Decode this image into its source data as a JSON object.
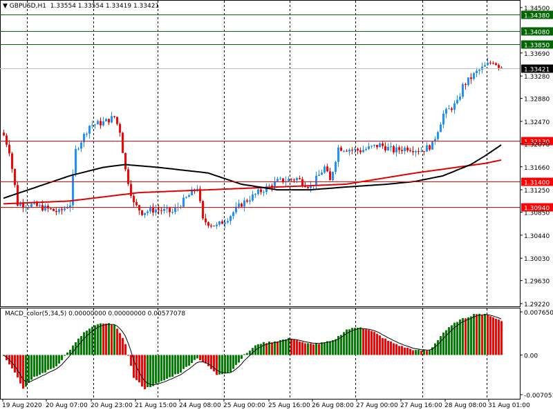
{
  "header": {
    "symbol": "GBPUSD,H1",
    "ohlc": "1.33554 1.33554 1.33419 1.33421"
  },
  "macd_header": {
    "label": "MACD_color(5,34,5) 0.00000000 0.00000000 0.00577078"
  },
  "colors": {
    "up": "#1e90ff",
    "down": "#ff0000",
    "ma_fast": "#000000",
    "ma_slow": "#e00000",
    "level_green": "#006400",
    "level_red": "#ff0000",
    "hist_up": "#008000",
    "hist_down": "#ff0000"
  },
  "price_axis": [
    "1.34500",
    "1.33690",
    "1.33280",
    "1.32880",
    "1.32470",
    "1.32070",
    "1.31660",
    "1.31250",
    "1.30850",
    "1.30440",
    "1.30030",
    "1.29630",
    "1.29220"
  ],
  "levels": [
    {
      "price": 1.3438,
      "label": "1.34380",
      "color": "green"
    },
    {
      "price": 1.3408,
      "label": "1.34080",
      "color": "green"
    },
    {
      "price": 1.3385,
      "label": "1.33850",
      "color": "green"
    },
    {
      "price": 1.3213,
      "label": "1.32130",
      "color": "red"
    },
    {
      "price": 1.314,
      "label": "1.31400",
      "color": "red"
    },
    {
      "price": 1.3094,
      "label": "1.30940",
      "color": "red"
    }
  ],
  "current_price": {
    "price": 1.33421,
    "label": "1.33421"
  },
  "macd_axis": {
    "top": "0.0076505",
    "zero": "0.00",
    "bottom": "-0.0070519"
  },
  "time_axis": [
    "19 Aug 2020",
    "20 Aug 07:00",
    "20 Aug 23:00",
    "21 Aug 15:00",
    "24 Aug 08:00",
    "25 Aug 00:00",
    "25 Aug 16:00",
    "26 Aug 08:00",
    "27 Aug 00:00",
    "27 Aug 16:00",
    "28 Aug 08:00",
    "31 Aug 01:00"
  ],
  "chart_data": {
    "type": "candlestick",
    "title": "GBPUSD,H1",
    "ylim": [
      1.2922,
      1.345
    ],
    "bars": 181,
    "close_path": [
      [
        0,
        1.3222
      ],
      [
        2,
        1.3195
      ],
      [
        5,
        1.31
      ],
      [
        10,
        1.3098
      ],
      [
        15,
        1.3092
      ],
      [
        20,
        1.3085
      ],
      [
        24,
        1.31
      ],
      [
        26,
        1.3195
      ],
      [
        31,
        1.324
      ],
      [
        36,
        1.3245
      ],
      [
        40,
        1.3255
      ],
      [
        42,
        1.323
      ],
      [
        44,
        1.316
      ],
      [
        47,
        1.31
      ],
      [
        50,
        1.3085
      ],
      [
        55,
        1.309
      ],
      [
        61,
        1.3085
      ],
      [
        66,
        1.311
      ],
      [
        70,
        1.313
      ],
      [
        72,
        1.307
      ],
      [
        77,
        1.306
      ],
      [
        81,
        1.3075
      ],
      [
        86,
        1.31
      ],
      [
        92,
        1.312
      ],
      [
        99,
        1.314
      ],
      [
        106,
        1.3145
      ],
      [
        111,
        1.313
      ],
      [
        116,
        1.3165
      ],
      [
        118,
        1.314
      ],
      [
        121,
        1.32
      ],
      [
        129,
        1.3195
      ],
      [
        136,
        1.3205
      ],
      [
        141,
        1.3195
      ],
      [
        146,
        1.32
      ],
      [
        151,
        1.3195
      ],
      [
        155,
        1.3205
      ],
      [
        159,
        1.326
      ],
      [
        164,
        1.328
      ],
      [
        166,
        1.331
      ],
      [
        171,
        1.3335
      ],
      [
        177,
        1.3355
      ],
      [
        180,
        1.33421
      ]
    ],
    "ma_fast": [
      [
        0,
        1.311
      ],
      [
        24,
        1.315
      ],
      [
        36,
        1.3165
      ],
      [
        44,
        1.317
      ],
      [
        56,
        1.3165
      ],
      [
        74,
        1.3155
      ],
      [
        86,
        1.3135
      ],
      [
        99,
        1.3125
      ],
      [
        111,
        1.3125
      ],
      [
        124,
        1.313
      ],
      [
        139,
        1.3135
      ],
      [
        149,
        1.314
      ],
      [
        159,
        1.315
      ],
      [
        169,
        1.317
      ],
      [
        174,
        1.3185
      ],
      [
        180,
        1.3205
      ]
    ],
    "ma_slow": [
      [
        0,
        1.31
      ],
      [
        24,
        1.3105
      ],
      [
        49,
        1.312
      ],
      [
        74,
        1.3125
      ],
      [
        99,
        1.313
      ],
      [
        124,
        1.3135
      ],
      [
        149,
        1.3155
      ],
      [
        174,
        1.3172
      ],
      [
        180,
        1.3178
      ]
    ],
    "macd_ylim": [
      -0.0070519,
      0.0076505
    ],
    "macd_path": [
      [
        0,
        -0.0001
      ],
      [
        4,
        -0.003
      ],
      [
        7,
        -0.006
      ],
      [
        11,
        -0.004
      ],
      [
        19,
        -0.002
      ],
      [
        24,
        0.001
      ],
      [
        29,
        0.004
      ],
      [
        34,
        0.0055
      ],
      [
        40,
        0.0055
      ],
      [
        44,
        0.002
      ],
      [
        47,
        -0.004
      ],
      [
        51,
        -0.006
      ],
      [
        56,
        -0.005
      ],
      [
        64,
        -0.003
      ],
      [
        70,
        -0.0005
      ],
      [
        74,
        -0.002
      ],
      [
        77,
        -0.0035
      ],
      [
        82,
        -0.003
      ],
      [
        87,
        0
      ],
      [
        92,
        0.002
      ],
      [
        99,
        0.0025
      ],
      [
        104,
        0.003
      ],
      [
        109,
        0.002
      ],
      [
        114,
        0.002
      ],
      [
        119,
        0.0025
      ],
      [
        124,
        0.0045
      ],
      [
        129,
        0.005
      ],
      [
        134,
        0.004
      ],
      [
        139,
        0.0025
      ],
      [
        144,
        0.0015
      ],
      [
        149,
        0.0008
      ],
      [
        154,
        0.0008
      ],
      [
        159,
        0.004
      ],
      [
        164,
        0.006
      ],
      [
        171,
        0.0074
      ],
      [
        176,
        0.007
      ],
      [
        180,
        0.006
      ]
    ]
  }
}
